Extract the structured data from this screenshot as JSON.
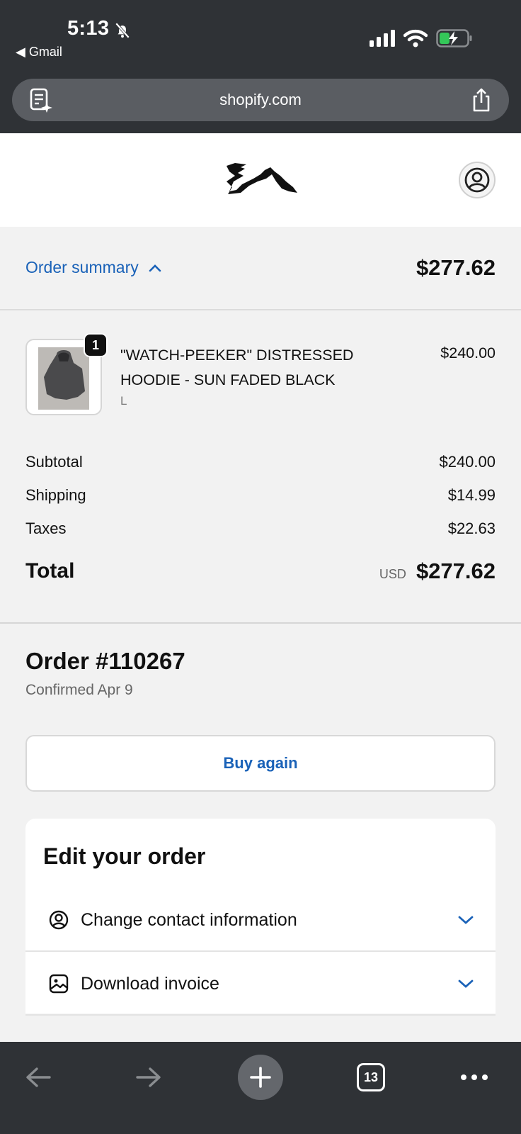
{
  "status_bar": {
    "time": "5:13",
    "back_app": "◀ Gmail"
  },
  "browser": {
    "url": "shopify.com",
    "open_tabs": "13"
  },
  "colors": {
    "accent": "#1a62b8",
    "chrome": "#2f3236"
  },
  "order_summary": {
    "toggle_label": "Order summary",
    "total": "$277.62",
    "item": {
      "quantity": "1",
      "title": "\"WATCH-PEEKER\" DISTRESSED HOODIE - SUN FADED BLACK",
      "variant": "L",
      "price": "$240.00"
    },
    "lines": [
      {
        "label": "Subtotal",
        "value": "$240.00"
      },
      {
        "label": "Shipping",
        "value": "$14.99"
      },
      {
        "label": "Taxes",
        "value": "$22.63"
      }
    ],
    "total_label": "Total",
    "currency": "USD",
    "total_value": "$277.62"
  },
  "order": {
    "title": "Order #110267",
    "confirmed": "Confirmed Apr 9",
    "buy_again_label": "Buy again"
  },
  "edit_order": {
    "title": "Edit your order",
    "options": [
      {
        "label": "Change contact information",
        "icon": "user-circle-icon"
      },
      {
        "label": "Download invoice",
        "icon": "image-icon"
      }
    ]
  }
}
